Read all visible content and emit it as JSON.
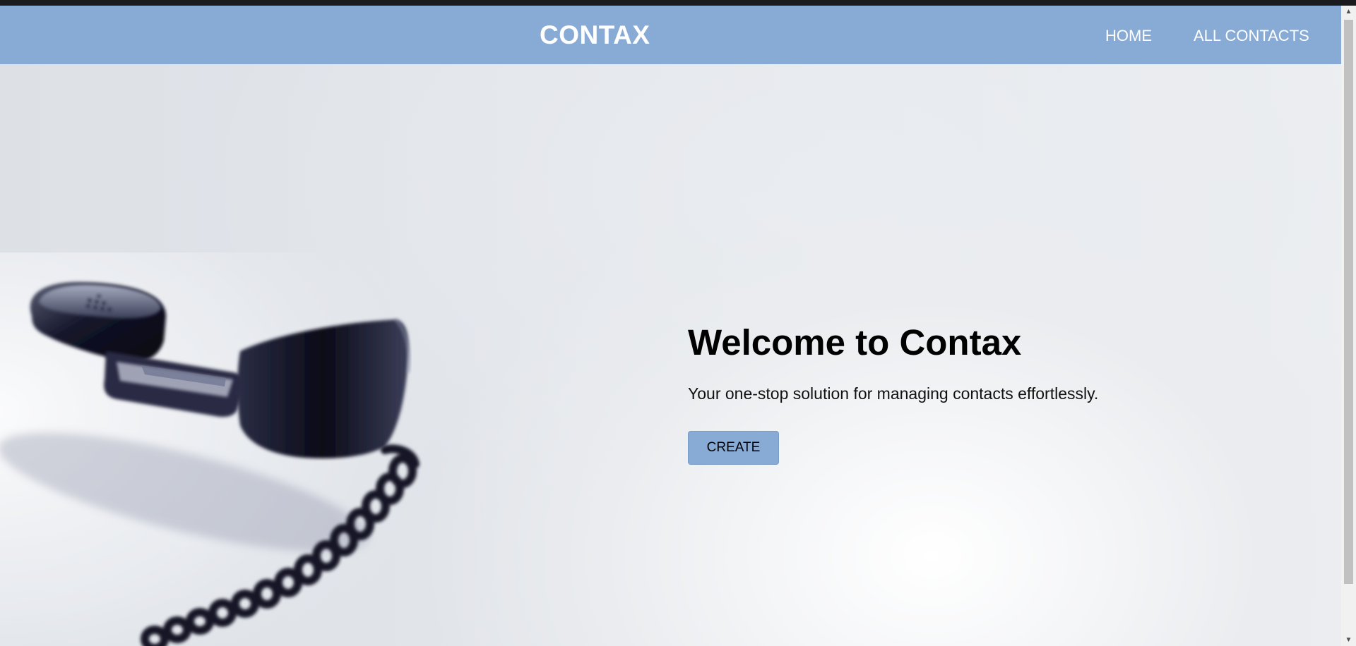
{
  "navbar": {
    "brand": "CONTAX",
    "links": [
      {
        "label": "HOME"
      },
      {
        "label": "ALL CONTACTS"
      }
    ]
  },
  "hero": {
    "title": "Welcome to Contax",
    "subtitle": "Your one-stop solution for managing contacts effortlessly.",
    "create_label": "CREATE"
  },
  "colors": {
    "navbar_bg": "#88abd6",
    "button_bg": "#88abd6",
    "brand_text": "#ffffff"
  },
  "icons": {
    "scroll_up": "▲",
    "scroll_down": "▼"
  }
}
